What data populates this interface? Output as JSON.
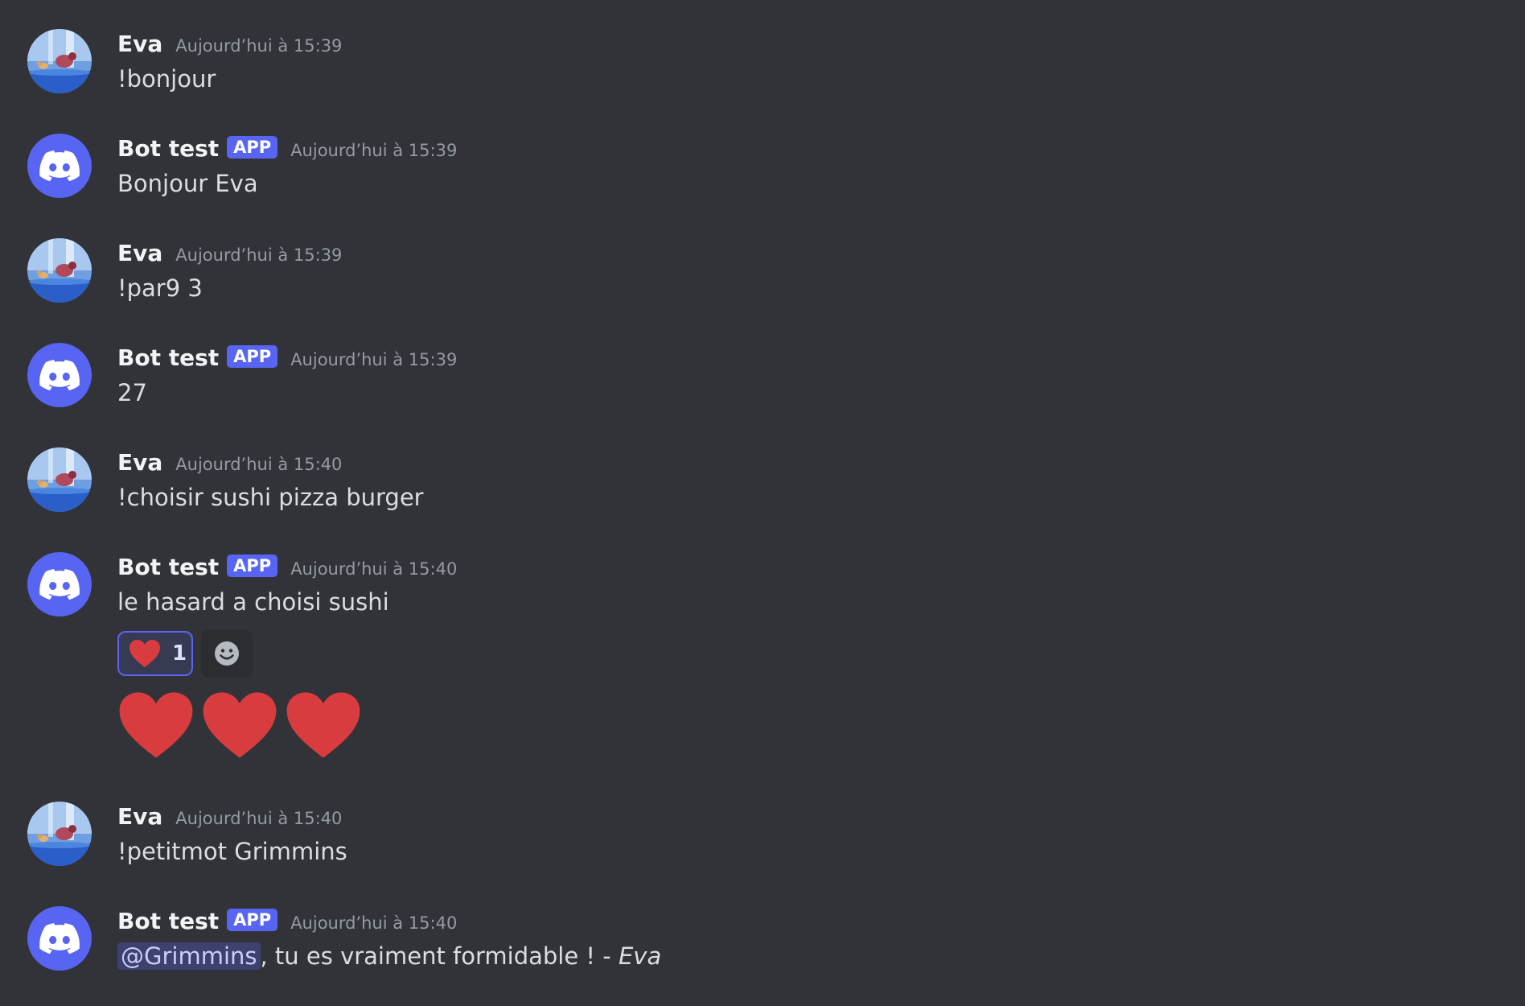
{
  "colors": {
    "background": "#313338",
    "bot_avatar": "#5865f2",
    "app_tag": "#5865f2",
    "heart": "#d83c3e",
    "mention_bg": "rgba(88,101,242,0.3)"
  },
  "messages": [
    {
      "author": "Eva",
      "is_bot": false,
      "timestamp": "Aujourd’hui à 15:39",
      "text": "!bonjour"
    },
    {
      "author": "Bot test",
      "is_bot": true,
      "tag": "APP",
      "timestamp": "Aujourd’hui à 15:39",
      "text": "Bonjour Eva"
    },
    {
      "author": "Eva",
      "is_bot": false,
      "timestamp": "Aujourd’hui à 15:39",
      "text": "!par9 3"
    },
    {
      "author": "Bot test",
      "is_bot": true,
      "tag": "APP",
      "timestamp": "Aujourd’hui à 15:39",
      "text": "27"
    },
    {
      "author": "Eva",
      "is_bot": false,
      "timestamp": "Aujourd’hui à 15:40",
      "text": "!choisir sushi pizza burger"
    },
    {
      "author": "Bot test",
      "is_bot": true,
      "tag": "APP",
      "timestamp": "Aujourd’hui à 15:40",
      "text": "le hasard a choisi sushi",
      "reaction": {
        "emoji": "heart-emoji",
        "count": "1"
      },
      "add_reaction_icon": "smiley-add-reaction-icon",
      "big_emojis": [
        "heart-emoji",
        "heart-emoji",
        "heart-emoji"
      ]
    },
    {
      "author": "Eva",
      "is_bot": false,
      "timestamp": "Aujourd’hui à 15:40",
      "text": "!petitmot Grimmins"
    },
    {
      "author": "Bot test",
      "is_bot": true,
      "tag": "APP",
      "timestamp": "Aujourd’hui à 15:40",
      "mention": "@Grimmins",
      "text_after_mention": ", tu es vraiment formidable ! - ",
      "signature": "Eva"
    }
  ]
}
